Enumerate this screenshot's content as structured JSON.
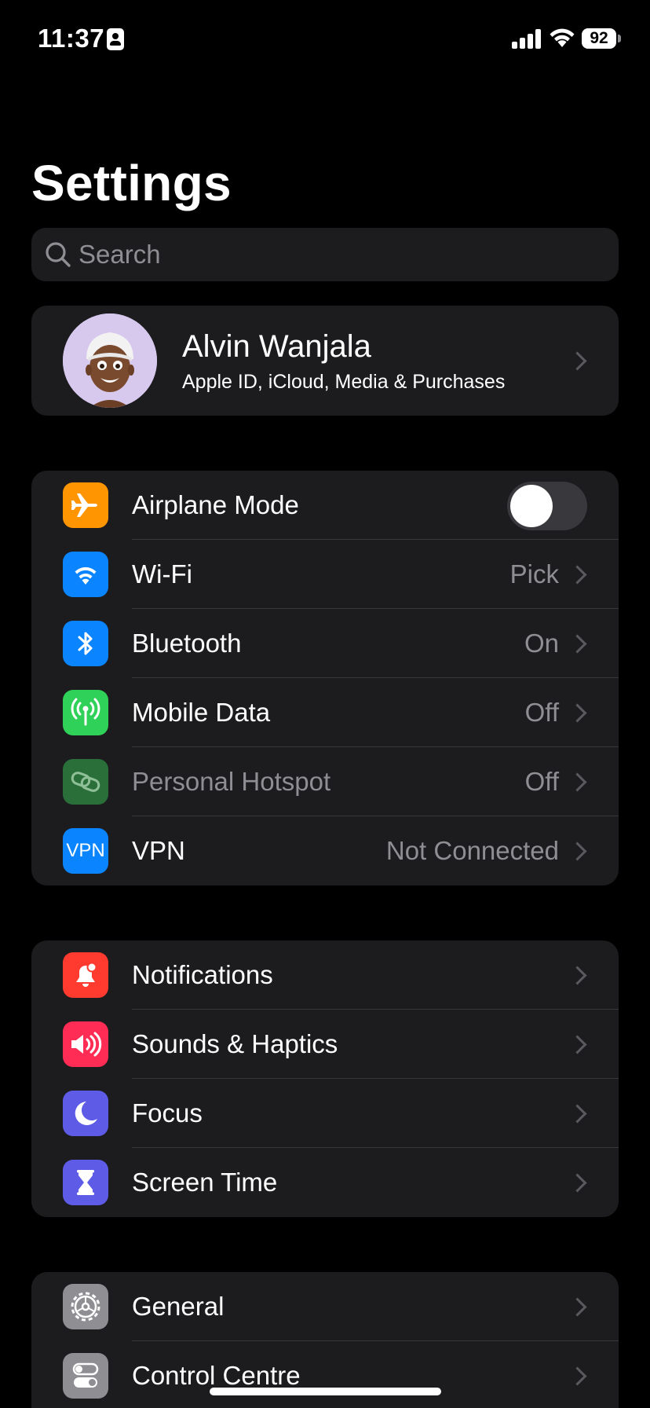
{
  "status_bar": {
    "time": "11:37",
    "battery": "92"
  },
  "page": {
    "title": "Settings"
  },
  "search": {
    "placeholder": "Search"
  },
  "profile": {
    "name": "Alvin Wanjala",
    "subtitle": "Apple ID, iCloud, Media & Purchases"
  },
  "connectivity": {
    "airplane_mode": {
      "label": "Airplane Mode",
      "icon": "airplane-icon",
      "color": "#ff9500",
      "enabled": false
    },
    "wifi": {
      "label": "Wi-Fi",
      "value": "Pick",
      "icon": "wifi-icon",
      "color": "#0a84ff"
    },
    "bluetooth": {
      "label": "Bluetooth",
      "value": "On",
      "icon": "bluetooth-icon",
      "color": "#0a84ff"
    },
    "mobile_data": {
      "label": "Mobile Data",
      "value": "Off",
      "icon": "antenna-icon",
      "color": "#30d158"
    },
    "hotspot": {
      "label": "Personal Hotspot",
      "value": "Off",
      "icon": "hotspot-icon",
      "color": "#2a6f3a"
    },
    "vpn": {
      "label": "VPN",
      "value": "Not Connected",
      "icon_text": "VPN",
      "icon": "vpn-icon",
      "color": "#0a84ff"
    }
  },
  "notifications_group": {
    "notifications": {
      "label": "Notifications",
      "icon": "bell-icon",
      "color": "#ff3b30"
    },
    "sounds": {
      "label": "Sounds & Haptics",
      "icon": "speaker-icon",
      "color": "#ff2d55"
    },
    "focus": {
      "label": "Focus",
      "icon": "moon-icon",
      "color": "#5e5ce6"
    },
    "screen_time": {
      "label": "Screen Time",
      "icon": "hourglass-icon",
      "color": "#5e5ce6"
    }
  },
  "general_group": {
    "general": {
      "label": "General",
      "icon": "gear-icon",
      "color": "#8e8e93"
    },
    "control_centre": {
      "label": "Control Centre",
      "icon": "toggles-icon",
      "color": "#8e8e93"
    }
  }
}
